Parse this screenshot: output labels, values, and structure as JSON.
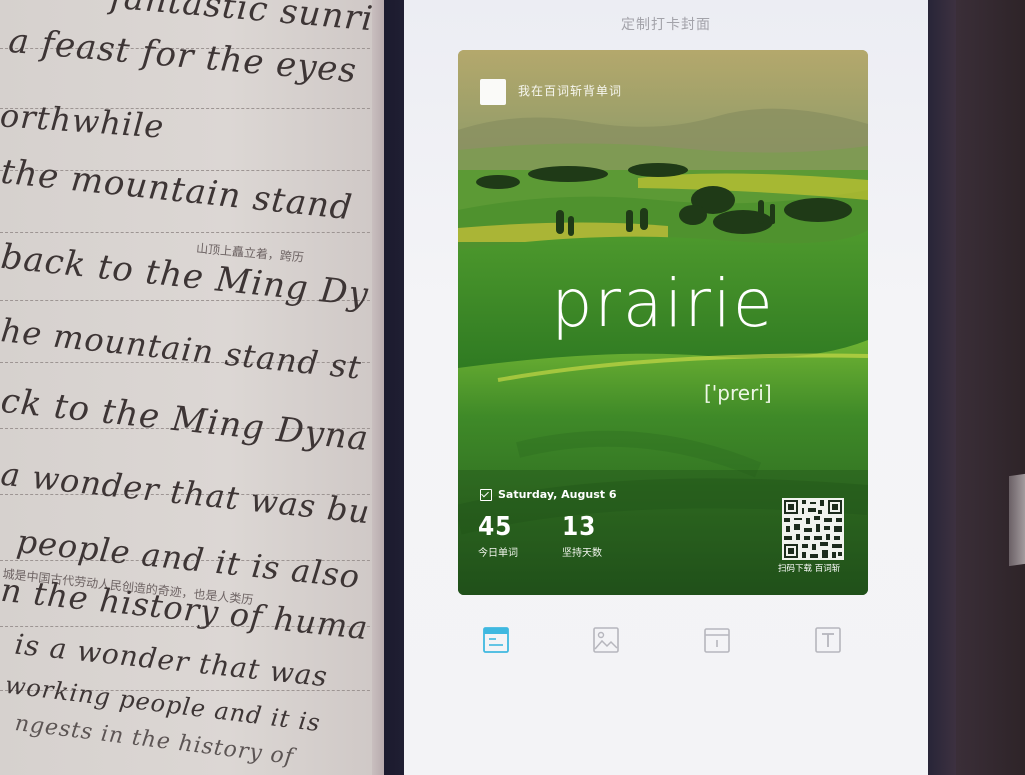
{
  "notebook": {
    "lines": [
      "fantastic sunri",
      "a feast for the eyes",
      "orthwhile",
      "the mountain stand",
      "back to the Ming Dy",
      "he mountain stand st",
      "ck to the Ming Dyna",
      "a wonder that was bu",
      "people and it is also",
      "n the history of huma",
      "is a wonder that was",
      "working people and it is",
      "ngests in the history of"
    ],
    "chinese": [
      "山顶上矗立着，跨历",
      "城是中国古代劳动人民创造的奇迹，也是人类历"
    ]
  },
  "screen": {
    "title": "定制打卡封面"
  },
  "card": {
    "brand": "我在百词斩背单词",
    "word": "prairie",
    "phonetic": "['preri]",
    "date": "Saturday,   August 6",
    "stats": [
      {
        "value": "45",
        "label": "今日单词"
      },
      {
        "value": "13",
        "label": "坚持天数"
      }
    ],
    "qr_label": "扫码下载 百词斩"
  },
  "tabs": [
    {
      "label": "",
      "icon": "template-icon",
      "active": true
    },
    {
      "label": "",
      "icon": "image-icon",
      "active": false
    },
    {
      "label": "",
      "icon": "calendar-icon",
      "active": false
    },
    {
      "label": "",
      "icon": "text-icon",
      "active": false
    }
  ],
  "colors": {
    "accent": "#3fb8e0",
    "tab_inactive": "#b6b6bd"
  }
}
